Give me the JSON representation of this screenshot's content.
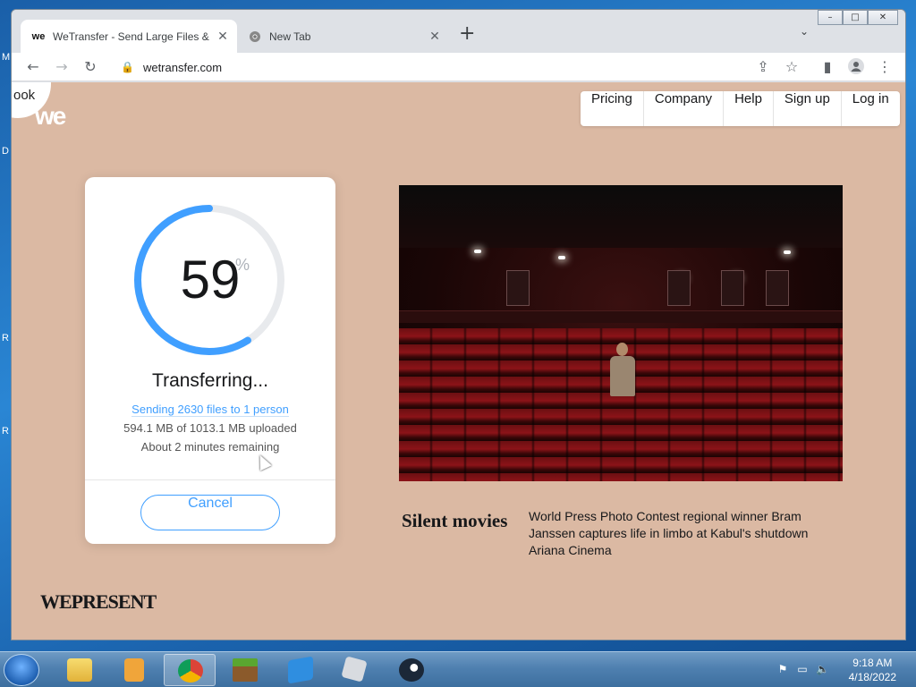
{
  "browser": {
    "tabs": [
      {
        "favicon": "we",
        "title": "WeTransfer - Send Large Files &",
        "active": true
      },
      {
        "favicon": "chrome-icon",
        "title": "New Tab",
        "active": false
      }
    ],
    "new_tab": "+",
    "url": "wetransfer.com",
    "window_controls": {
      "minimize": "–",
      "maximize": "□",
      "close": "✕"
    }
  },
  "site": {
    "logo": "we",
    "logo_blob_text": "ook",
    "nav": [
      "Pricing",
      "Company",
      "Help",
      "Sign up",
      "Log in"
    ]
  },
  "transfer": {
    "progress": 59,
    "percent_sign": "%",
    "status": "Transferring...",
    "sending": "Sending 2630 files to 1 person",
    "uploaded": "594.1 MB of 1013.1 MB uploaded",
    "remaining": "About 2 minutes remaining",
    "cancel": "Cancel",
    "ring_color": "#409fff"
  },
  "feature": {
    "title": "Silent movies",
    "description": "World Press Photo Contest regional winner Bram Janssen captures life in limbo at Kabul's shutdown Ariana Cinema"
  },
  "footer": {
    "brand": "WEPRESENT"
  },
  "taskbar": {
    "apps": [
      "file-explorer-icon",
      "media-player-icon",
      "chrome-icon",
      "minecraft-icon",
      "blue-app-icon",
      "roblox-icon",
      "steam-icon"
    ],
    "clock_time": "9:18 AM",
    "clock_date": "4/18/2022"
  },
  "desktop": {
    "edge_letters": [
      "M",
      "D",
      "R",
      "R"
    ]
  }
}
